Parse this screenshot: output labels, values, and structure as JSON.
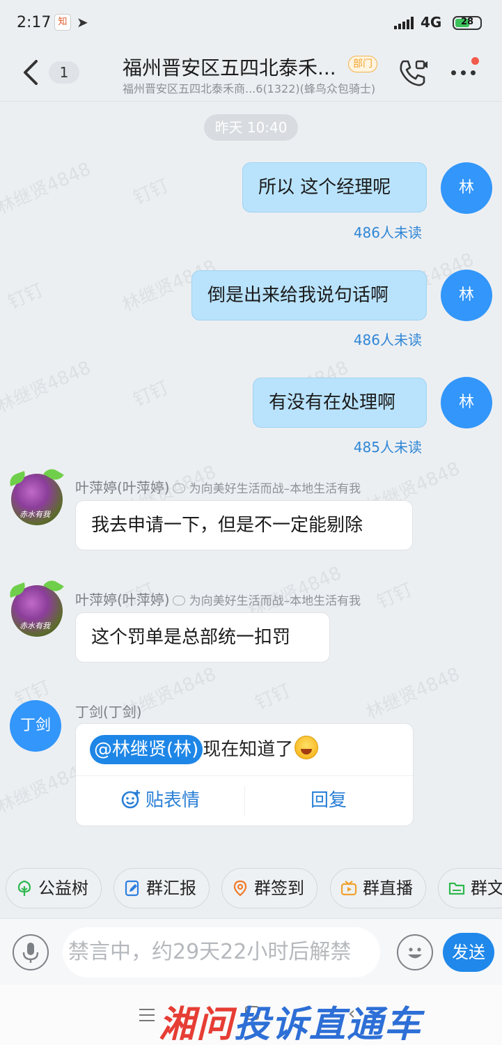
{
  "status_bar": {
    "time": "2:17",
    "notif_app_glyph": "知",
    "network": "4G",
    "battery": "28",
    "battery_color": "#3cc25a"
  },
  "header": {
    "back_count": "1",
    "title": "福州晋安区五四北泰禾...",
    "tag": "部门",
    "subtitle": "福州晋安区五四北泰禾商...6(1322)(蜂鸟众包骑士)"
  },
  "watermark": {
    "name": "林继贤4848",
    "app": "钉钉"
  },
  "messages": {
    "timestamp": "昨天 10:40",
    "outgoing": [
      {
        "text": "所以  这个经理呢",
        "unread": "486人未读",
        "avatar": "林"
      },
      {
        "text": "倒是出来给我说句话啊",
        "unread": "486人未读",
        "avatar": "林"
      },
      {
        "text": "有没有在处理啊",
        "unread": "485人未读",
        "avatar": "林"
      }
    ],
    "incoming": [
      {
        "sender": "叶萍婷(叶萍婷)",
        "signature": "为向美好生活而战–本地生活有我",
        "text": "我去申请一下，但是不一定能剔除",
        "avatar_text": "赤水有我"
      },
      {
        "sender": "叶萍婷(叶萍婷)",
        "signature": "为向美好生活而战–本地生活有我",
        "text": "这个罚单是总部统一扣罚",
        "avatar_text": "赤水有我"
      }
    ],
    "card": {
      "sender": "丁剑(丁剑)",
      "avatar": "丁剑",
      "mention": "@林继贤(林)",
      "text": "现在知道了",
      "action_emoji": "贴表情",
      "action_reply": "回复"
    }
  },
  "quick_actions": [
    {
      "label": "公益树",
      "icon": "tree-icon",
      "color": "#2db84d"
    },
    {
      "label": "群汇报",
      "icon": "report-icon",
      "color": "#2d7fe0"
    },
    {
      "label": "群签到",
      "icon": "location-pin-icon",
      "color": "#f07a2a"
    },
    {
      "label": "群直播",
      "icon": "tv-icon",
      "color": "#f0a22e"
    },
    {
      "label": "群文",
      "icon": "folder-icon",
      "color": "#2db84d"
    }
  ],
  "input": {
    "placeholder": "禁言中，约29天22小时后解禁",
    "send_label": "发送"
  },
  "footer_logo": {
    "part1": "湘问",
    "part2": "投诉直通车"
  },
  "colors": {
    "accent": "#1f88ea",
    "outgoing_bubble": "#b9e3fc",
    "background": "#eceff2"
  }
}
